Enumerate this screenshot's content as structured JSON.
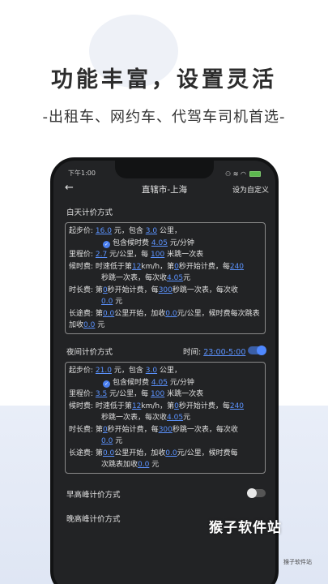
{
  "promo": {
    "headline": "功能丰富，设置灵活",
    "subline": "-出租车、网约车、代驾车司机首选-"
  },
  "status_bar": {
    "time": "下午1:00",
    "icons": "⚇ ≋ ◠"
  },
  "nav": {
    "back_icon": "←",
    "title": "直辖市-上海",
    "action": "设为自定义"
  },
  "day_pricing": {
    "title": "白天计价方式",
    "start": {
      "label": "起步价:",
      "price": "16.0",
      "t1": "元，包含",
      "km": "3.0",
      "t2": "公里，"
    },
    "waiting_included": {
      "t1": "包含候时费",
      "price": "4.05",
      "t2": "元/分钟"
    },
    "mileage": {
      "label": "里程价:",
      "price": "2.7",
      "t1": "元/公里，每",
      "meters": "100",
      "t2": "米跳一次表"
    },
    "waiting": {
      "label": "候时费:",
      "t1": "时速低于第",
      "speed": "12",
      "t2": "km/h，第",
      "start": "0",
      "t3": "秒开始计费，每",
      "interval": "240",
      "t4": "秒跳一次表，每次收",
      "amount": "4.05",
      "t5": "元"
    },
    "duration": {
      "label": "时长费:",
      "t1": "第",
      "start": "0",
      "t2": "秒开始计费，每",
      "interval": "300",
      "t3": "秒跳一次表，每次收",
      "amount": "0.0",
      "t4": "元"
    },
    "long_distance": {
      "label": "长途费:",
      "t1": "第",
      "km": "0.0",
      "t2": "公里开始，加收",
      "add": "0.0",
      "t3": "元/公里，候时费每次跳表加收",
      "wait_add": "0.0",
      "t4": "元"
    }
  },
  "night_pricing": {
    "title": "夜间计价方式",
    "time_label": "时间:",
    "time_range": "23:00-5:00",
    "enabled": true,
    "start": {
      "label": "起步价:",
      "price": "21.0",
      "t1": "元，包含",
      "km": "3.0",
      "t2": "公里，"
    },
    "waiting_included": {
      "t1": "包含候时费",
      "price": "4.05",
      "t2": "元/分钟"
    },
    "mileage": {
      "label": "里程价:",
      "price": "3.5",
      "t1": "元/公里，每",
      "meters": "100",
      "t2": "米跳一次表"
    },
    "waiting": {
      "label": "候时费:",
      "t1": "时速低于第",
      "speed": "12",
      "t2": "km/h，第",
      "start": "0",
      "t3": "秒开始计费，每",
      "interval": "240",
      "t4": "秒跳一次表，每次收",
      "amount": "4.05",
      "t5": "元"
    },
    "duration": {
      "label": "时长费:",
      "t1": "第",
      "start": "0",
      "t2": "秒开始计费，每",
      "interval": "300",
      "t3": "秒跳一次表，每次收",
      "amount": "0.0",
      "t4": "元"
    },
    "long_distance": {
      "label": "长途费:",
      "t1": "第",
      "km": "0.0",
      "t2": "公里开始，加收",
      "add": "0.0",
      "t3": "元/公里，候时费每",
      "t3b": "次跳表加收",
      "wait_add": "0.0",
      "t4": "元"
    }
  },
  "morning_peak": {
    "title": "早高峰计价方式",
    "enabled": false
  },
  "evening_peak": {
    "title": "晚高峰计价方式"
  },
  "watermark": {
    "text": "猴子软件站",
    "small": "猴子软件站"
  },
  "colors": {
    "accent": "#5b93ff",
    "phone_bg": "#222325"
  }
}
